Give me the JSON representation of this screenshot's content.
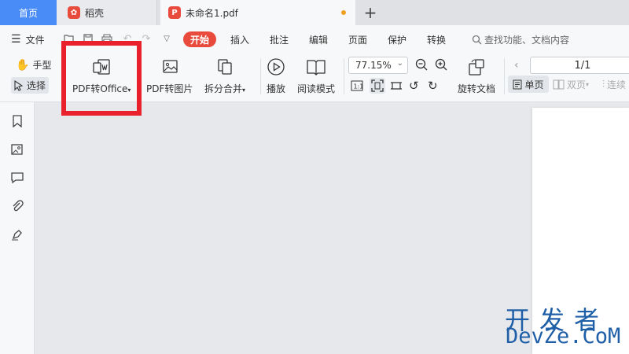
{
  "tabs": {
    "home": "首页",
    "docer": "稻壳",
    "document": "未命名1.pdf",
    "add": "+"
  },
  "menu": {
    "file": "文件",
    "items": [
      "开始",
      "插入",
      "批注",
      "编辑",
      "页面",
      "保护",
      "转换"
    ],
    "search": "查找功能、文档内容"
  },
  "ribbon": {
    "hand": "手型",
    "select": "选择",
    "pdf_to_office": "PDF转Office",
    "pdf_to_image": "PDF转图片",
    "split_merge": "拆分合并",
    "play": "播放",
    "read_mode": "阅读模式",
    "zoom": "77.15%",
    "rotate_doc": "旋转文档",
    "page_number": "1/1",
    "single_page": "单页",
    "double_page": "双页",
    "continuous": "连续"
  },
  "watermark": {
    "line1": "开发者",
    "line2": "DevZe.CoM"
  },
  "colors": {
    "accent": "#e84b3c",
    "home_tab": "#4a8cf7",
    "highlight": "#e8212c",
    "watermark": "#1f5fa8"
  }
}
